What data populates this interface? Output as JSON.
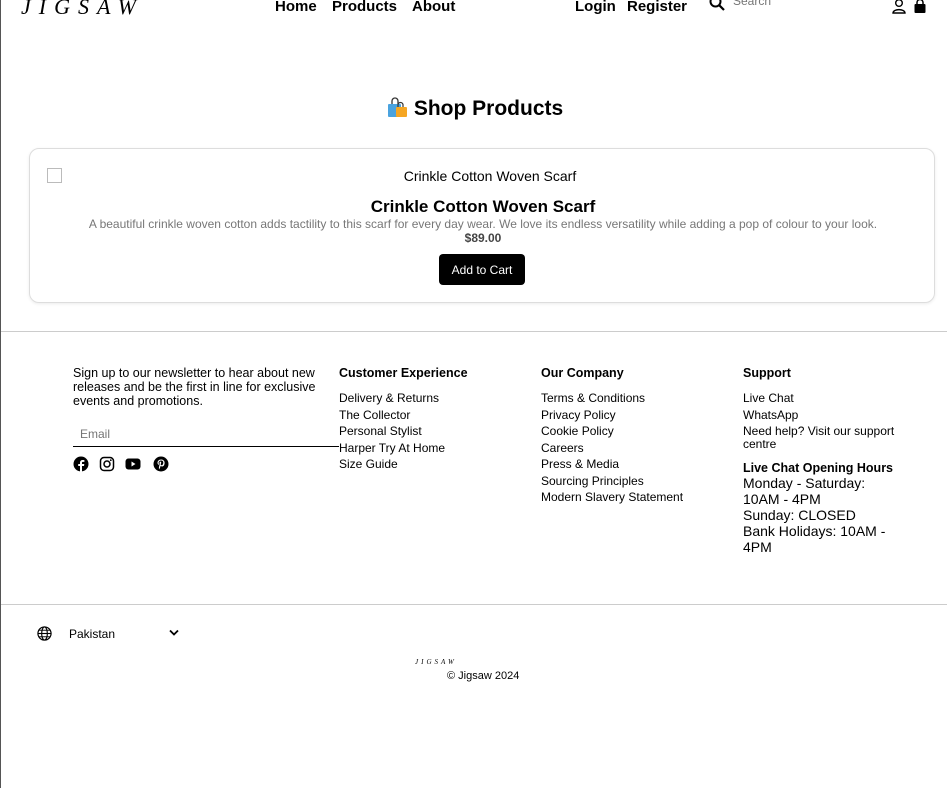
{
  "header": {
    "logo": "JIGSAW",
    "nav": {
      "home": "Home",
      "products": "Products",
      "about": "About"
    },
    "auth": {
      "login": "Login",
      "register": "Register"
    },
    "search_placeholder": "Search"
  },
  "page": {
    "title": "Shop Products"
  },
  "product": {
    "image_alt": "Crinkle Cotton Woven Scarf",
    "name": "Crinkle Cotton Woven Scarf",
    "description": "A beautiful crinkle woven cotton adds tactility to this scarf for every day wear. We love its endless versatility while adding a pop of colour to your look.",
    "price": "$89.00",
    "add_to_cart": "Add to Cart"
  },
  "footer": {
    "newsletter_text": "Sign up to our newsletter to hear about new releases and be the first in line for exclusive events and promotions.",
    "email_placeholder": "Email",
    "social_icons": [
      "facebook-icon",
      "instagram-icon",
      "youtube-icon",
      "pinterest-icon"
    ],
    "customer_experience": {
      "title": "Customer Experience",
      "links": [
        "Delivery & Returns",
        "The Collector",
        "Personal Stylist",
        "Harper Try At Home",
        "Size Guide"
      ]
    },
    "our_company": {
      "title": "Our Company",
      "links": [
        "Terms & Conditions",
        "Privacy Policy",
        "Cookie Policy",
        "Careers",
        "Press & Media",
        "Sourcing Principles",
        "Modern Slavery Statement"
      ]
    },
    "support": {
      "title": "Support",
      "links": [
        "Live Chat",
        "WhatsApp",
        "Need help? Visit our support centre"
      ],
      "hours_title": "Live Chat Opening Hours",
      "hours": [
        "Monday - Saturday: 10AM - 4PM",
        "Sunday: CLOSED",
        "Bank Holidays: 10AM - 4PM"
      ]
    }
  },
  "bottom": {
    "country": "Pakistan",
    "mini_logo": "JIGSAW",
    "copyright": "© Jigsaw 2024"
  }
}
